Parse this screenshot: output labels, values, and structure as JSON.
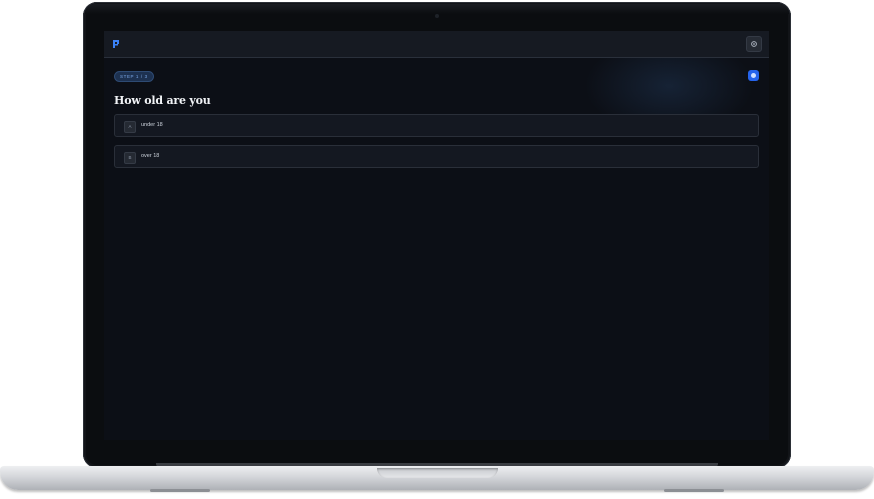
{
  "app": {
    "logo_icon": "brand-logo-icon",
    "settings_icon": "gear-icon",
    "help_icon": "help-icon",
    "accent_color": "#2563eb"
  },
  "quiz": {
    "step_label": "STEP 1 / 3",
    "question": "How old are you",
    "options": [
      {
        "key": "A",
        "label": "under 18"
      },
      {
        "key": "B",
        "label": "over 18"
      }
    ]
  }
}
